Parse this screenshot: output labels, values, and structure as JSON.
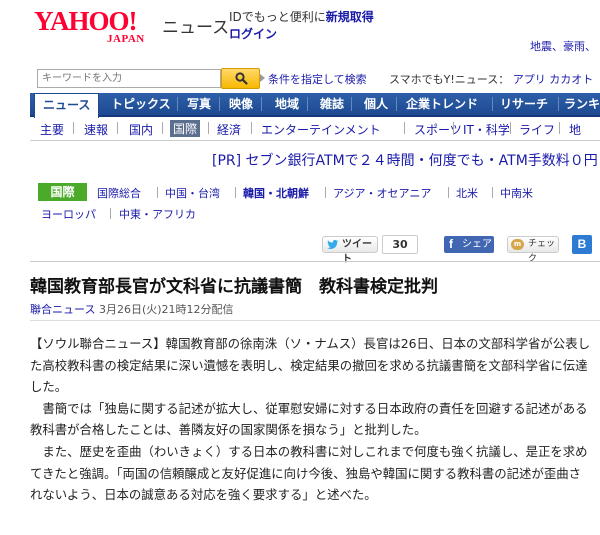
{
  "header": {
    "logo_main": "YAHOO!",
    "logo_sub": "JAPAN",
    "news": "ニュース",
    "promo_text": "IDでもっと便利に",
    "promo_link": "新規取得",
    "login": "ログイン",
    "right_links": "地震、豪雨、"
  },
  "search": {
    "placeholder": "キーワードを入力",
    "advanced": "条件を指定して検索",
    "smartphone": "スマホでもY!ニュース：",
    "app": "アプリ",
    "kakaku": "カカオト"
  },
  "nav": {
    "items": [
      "ニュース",
      "トピックス",
      "写真",
      "映像",
      "地域",
      "雑誌",
      "個人",
      "企業トレンド",
      "リサーチ",
      "ランキ"
    ]
  },
  "subnav": {
    "items": [
      "主要",
      "速報",
      "国内",
      "国際",
      "経済",
      "エンターテインメント",
      "スポーツ",
      "IT・科学",
      "ライフ",
      "地"
    ]
  },
  "pr": "[PR] セブン銀行ATMで２４時間・何度でも・ATM手数料０円",
  "category": {
    "label": "国際",
    "row1": [
      "国際総合",
      "中国・台湾",
      "韓国・北朝鮮",
      "アジア・オセアニア",
      "北米",
      "中南米"
    ],
    "row2": [
      "ヨーロッパ",
      "中東・アフリカ"
    ]
  },
  "social": {
    "tweet": "ツイート",
    "tweet_count": "30",
    "share": "シェア",
    "check": "チェック",
    "hatena": "B"
  },
  "article": {
    "headline": "韓国教育部長官が文科省に抗議書簡　教科書検定批判",
    "source": "聯合ニュース",
    "datetime": "3月26日(火)21時12分配信",
    "paragraphs": [
      "【ソウル聯合ニュース】韓国教育部の徐南洙（ソ・ナムス）長官は26日、日本の文部科学省が公表した高校教科書の検定結果に深い遺憾を表明し、検定結果の撤回を求める抗議書簡を文部科学省に伝達した。",
      "　書簡では「独島に関する記述が拡大し、従軍慰安婦に対する日本政府の責任を回避する記述がある教科書が合格したことは、善隣友好の国家関係を損なう」と批判した。",
      "　また、歴史を歪曲（わいきょく）する日本の教科書に対しこれまで何度も強く抗議し、是正を求めてきたと強調。「両国の信頼醸成と友好促進に向け今後、独島や韓国に関する教科書の記述が歪曲されないよう、日本の誠意ある対応を強く要求する」と述べた。"
    ]
  },
  "colors": {
    "yahoo_red": "#ff0033",
    "nav_blue": "#1d4a91",
    "link_blue": "#1a1aaa",
    "category_green": "#4caa2a"
  }
}
